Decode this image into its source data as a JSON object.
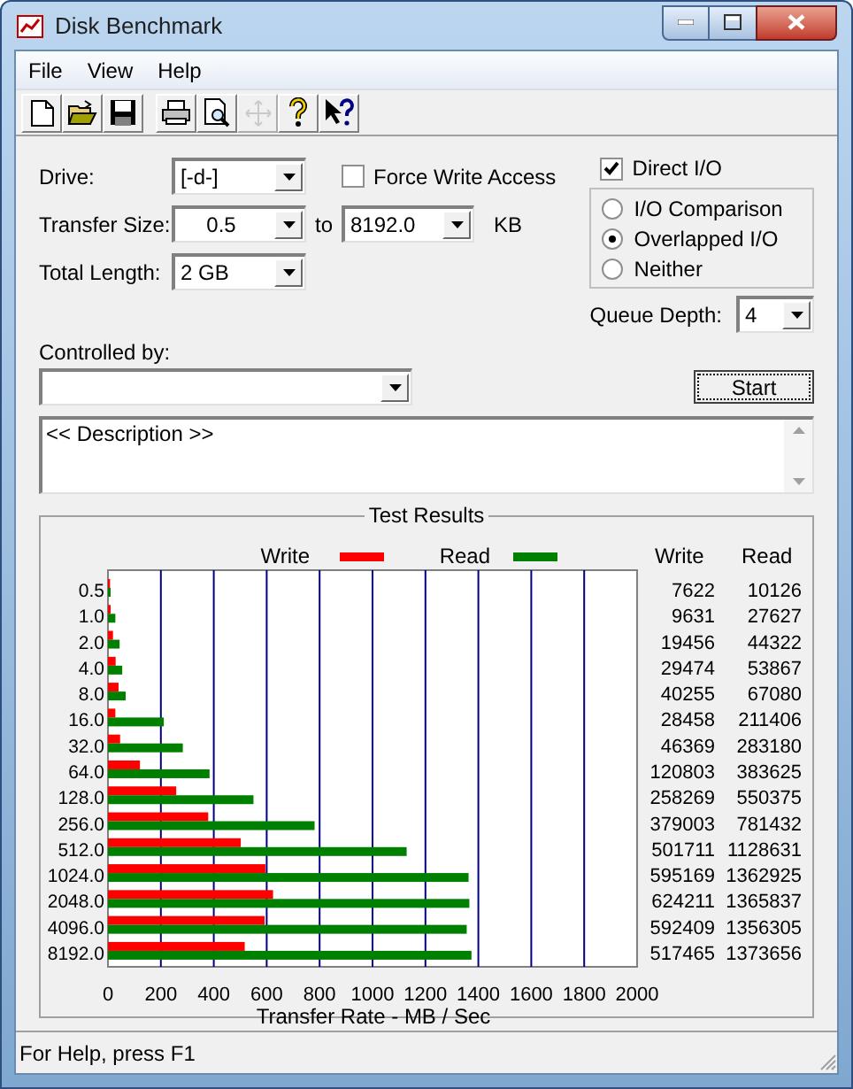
{
  "window": {
    "title": "Disk Benchmark"
  },
  "menu": [
    "File",
    "View",
    "Help"
  ],
  "toolbar": [
    {
      "kind": "new",
      "disabled": false
    },
    {
      "kind": "open",
      "disabled": false
    },
    {
      "kind": "save",
      "disabled": false
    },
    {
      "kind": "print",
      "disabled": false
    },
    {
      "kind": "preview",
      "disabled": false
    },
    {
      "kind": "move",
      "disabled": true
    },
    {
      "kind": "help",
      "disabled": false
    },
    {
      "kind": "context_help",
      "disabled": false
    }
  ],
  "drive": {
    "label": "Drive:",
    "value": "[-d-]"
  },
  "force_write_access": {
    "label": "Force Write Access",
    "checked": false
  },
  "direct_io": {
    "label": "Direct I/O",
    "checked": true
  },
  "transfer_size": {
    "label": "Transfer Size:",
    "from": "0.5",
    "to_label": "to",
    "to": "8192.0",
    "unit": "KB"
  },
  "total_length": {
    "label": "Total Length:",
    "value": "2 GB"
  },
  "io_modes": [
    {
      "label": "I/O Comparison",
      "selected": false
    },
    {
      "label": "Overlapped I/O",
      "selected": true
    },
    {
      "label": "Neither",
      "selected": false
    }
  ],
  "queue_depth": {
    "label": "Queue Depth:",
    "value": "4"
  },
  "controlled_by": {
    "label": "Controlled by:"
  },
  "start_button": "Start",
  "description": "<< Description >>",
  "test_results": {
    "title": "Test Results",
    "table": {
      "columns": [
        "Write",
        "Read"
      ],
      "rows": [
        [
          "7622",
          "10126"
        ],
        [
          "9631",
          "27627"
        ],
        [
          "19456",
          "44322"
        ],
        [
          "29474",
          "53867"
        ],
        [
          "40255",
          "67080"
        ],
        [
          "28458",
          "211406"
        ],
        [
          "46369",
          "283180"
        ],
        [
          "120803",
          "383625"
        ],
        [
          "258269",
          "550375"
        ],
        [
          "379003",
          "781432"
        ],
        [
          "501711",
          "1128631"
        ],
        [
          "595169",
          "1362925"
        ],
        [
          "624211",
          "1365837"
        ],
        [
          "592409",
          "1356305"
        ],
        [
          "517465",
          "1373656"
        ]
      ]
    },
    "chart_data": {
      "type": "bar",
      "orientation": "horizontal",
      "xlabel": "Transfer Rate - MB / Sec",
      "categories": [
        "0.5",
        "1.0",
        "2.0",
        "4.0",
        "8.0",
        "16.0",
        "32.0",
        "64.0",
        "128.0",
        "256.0",
        "512.0",
        "1024.0",
        "2048.0",
        "4096.0",
        "8192.0"
      ],
      "series": [
        {
          "name": "Write",
          "color": "#ff0000",
          "values": [
            8,
            10,
            19,
            29,
            40,
            28,
            46,
            121,
            258,
            379,
            502,
            595,
            624,
            592,
            517
          ]
        },
        {
          "name": "Read",
          "color": "#008000",
          "values": [
            10,
            28,
            44,
            54,
            67,
            211,
            283,
            384,
            550,
            781,
            1129,
            1363,
            1366,
            1356,
            1374
          ]
        }
      ],
      "legend": true,
      "grid": true,
      "xlim": [
        0,
        2000
      ],
      "xticks": [
        0,
        200,
        400,
        600,
        800,
        1000,
        1200,
        1400,
        1600,
        1800,
        2000
      ]
    }
  },
  "status_bar": "For Help, press F1"
}
